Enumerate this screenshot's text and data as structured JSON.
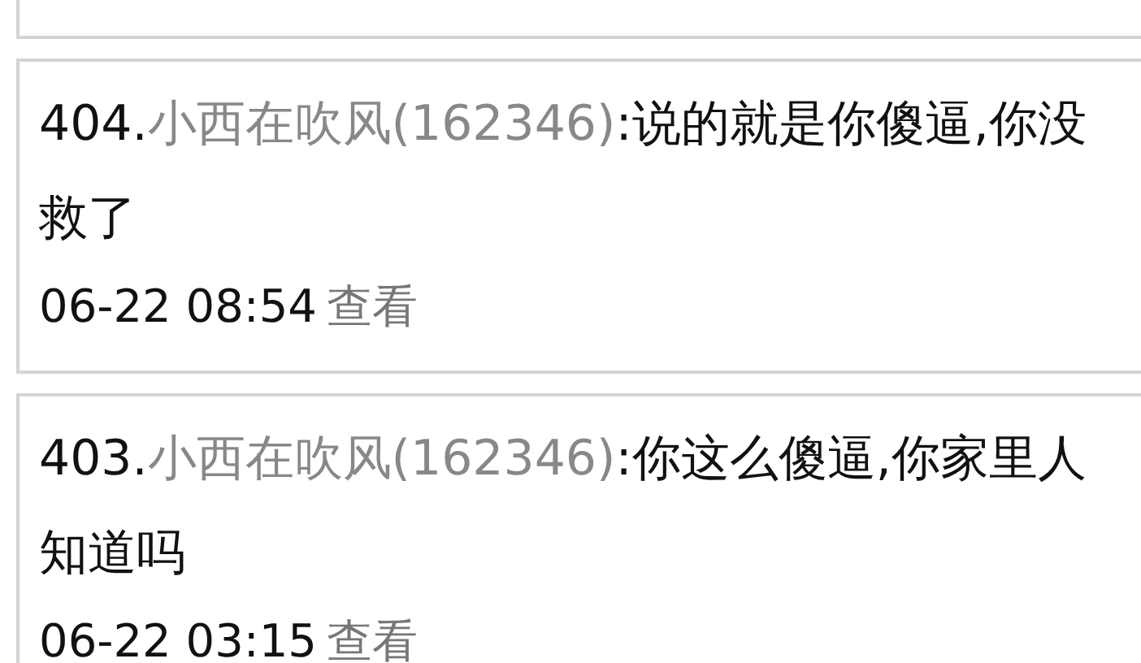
{
  "comments": [
    {
      "number": "404.",
      "user": "小西在吹风(162346)",
      "content": ":说的就是你傻逼,你没救了",
      "date": "06-22 08:54",
      "action": "查看"
    },
    {
      "number": "403.",
      "user": "小西在吹风(162346)",
      "content": ":你这么傻逼,你家里人知道吗",
      "date": "06-22 03:15",
      "action": "查看"
    }
  ]
}
